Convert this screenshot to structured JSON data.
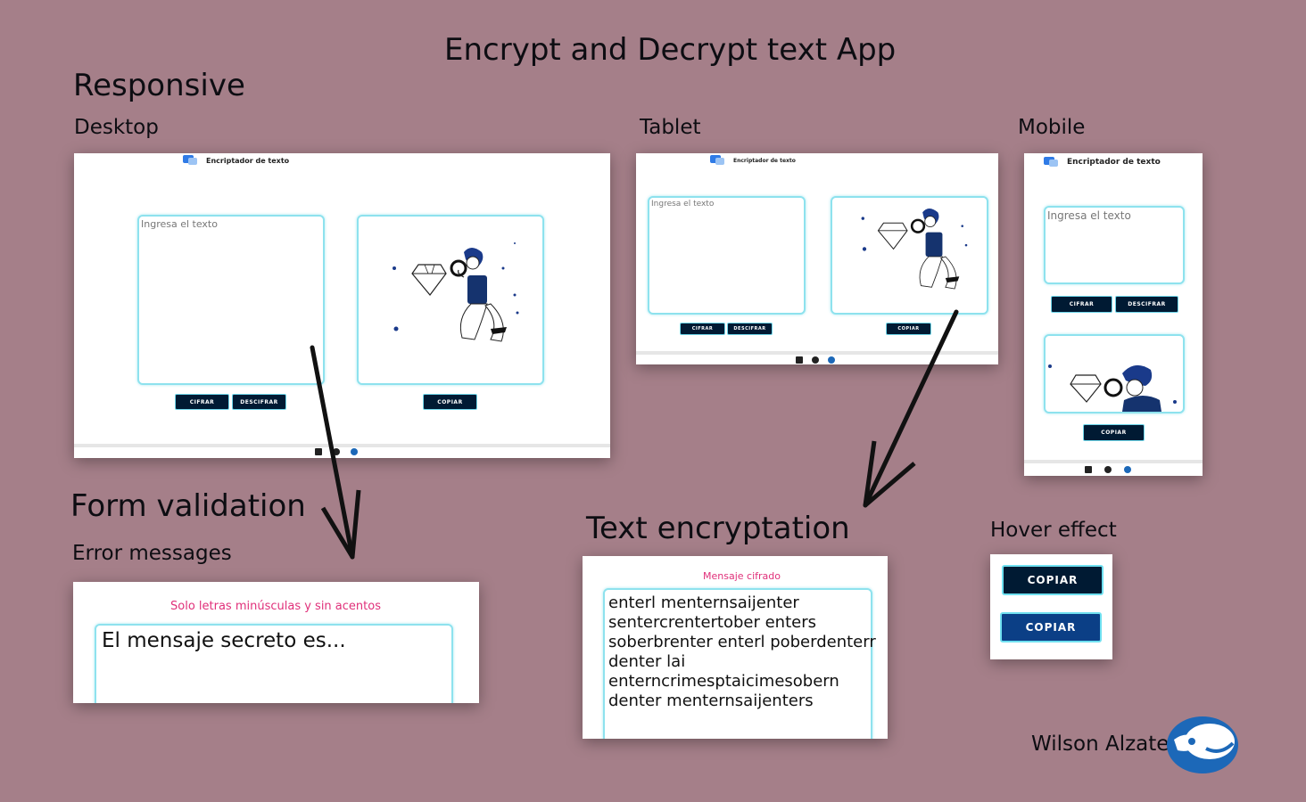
{
  "title": "Encrypt and Decrypt text App",
  "sections": {
    "responsive": "Responsive",
    "desktop": "Desktop",
    "tablet": "Tablet",
    "mobile": "Mobile",
    "form_validation": "Form validation",
    "error_messages": "Error messages",
    "text_encryption": "Text encryptation",
    "hover_effect": "Hover effect"
  },
  "app": {
    "brand_name": "Encriptador de texto",
    "input_placeholder": "Ingresa el texto",
    "encrypt_label": "CIFRAR",
    "decrypt_label": "DESCIFRAR",
    "copy_label": "COPIAR",
    "footer_icons": [
      "linkedin-icon",
      "github-icon",
      "logo-icon"
    ]
  },
  "validation": {
    "error_message": "Solo letras minúsculas y sin acentos",
    "input_value": "El mensaje secreto es..."
  },
  "encryption": {
    "label": "Mensaje cifrado",
    "lines": [
      "enterl menternsaijenter",
      "sentercrentertober enters",
      "soberbrenter enterl poberdenterr",
      "denter lai",
      "enterncrimesptaicimesobern",
      "denter menternsaijenters"
    ]
  },
  "hover": {
    "normal_label": "COPIAR",
    "hover_label": "COPIAR",
    "normal_color": "#001a33",
    "hover_color": "#0b3f86"
  },
  "author": "Wilson Alzate",
  "colors": {
    "background": "#a57f89",
    "accent_border": "#8ee2ee",
    "error": "#e0307a",
    "button": "#001a33"
  }
}
